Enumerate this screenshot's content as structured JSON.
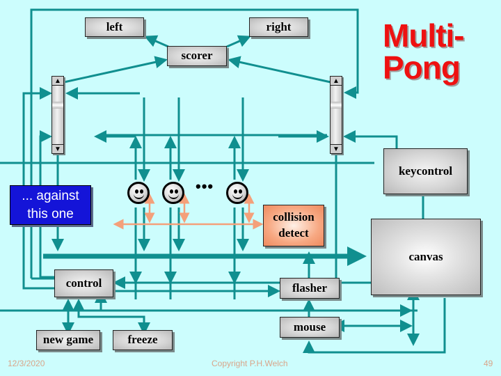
{
  "slide": {
    "title_line1": "Multi-",
    "title_line2": "Pong",
    "date": "12/3/2020",
    "copyright": "Copyright P.H.Welch",
    "page_number": "49"
  },
  "processes": {
    "left": "left",
    "right": "right",
    "scorer": "scorer",
    "keycontrol": "keycontrol",
    "collision_line1": "collision",
    "collision_line2": "detect",
    "canvas": "canvas",
    "control": "control",
    "flasher": "flasher",
    "mouse": "mouse",
    "new_game": "new game",
    "freeze": "freeze"
  },
  "callout": {
    "line1": "... against",
    "line2": "this one"
  },
  "ellipsis": "•••",
  "colors": {
    "background": "#ccfdfd",
    "wire": "#108f8f",
    "collision_wire": "#f4a07a",
    "title": "#ee1111",
    "callout_fill": "#1414d8"
  },
  "scrollbars": {
    "up_glyph": "▲",
    "down_glyph": "▼"
  }
}
